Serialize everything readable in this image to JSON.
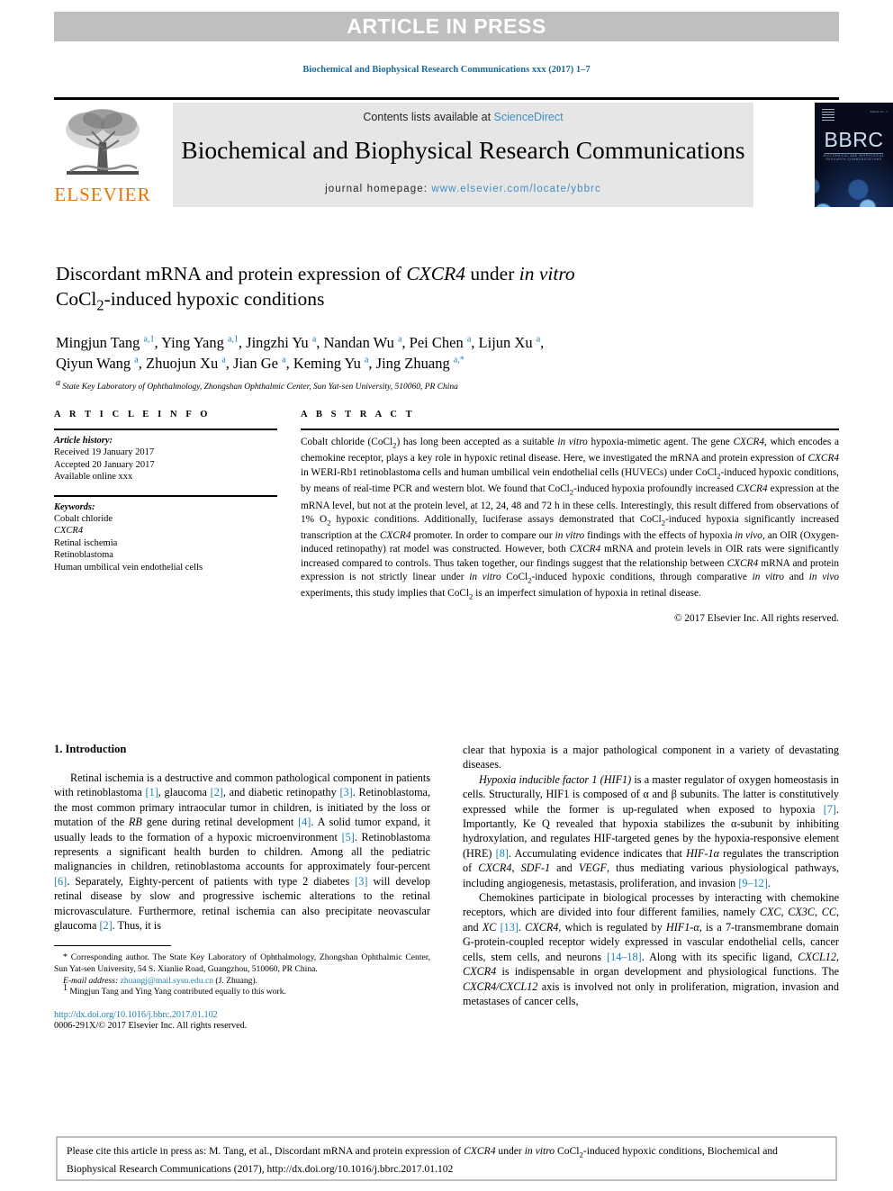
{
  "banner": {
    "label": "ARTICLE IN PRESS"
  },
  "running_head": "Biochemical and Biophysical Research Communications xxx (2017) 1–7",
  "masthead": {
    "publisher_word": "ELSEVIER",
    "contents_prefix": "Contents lists available at ",
    "contents_link": "ScienceDirect",
    "journal_title": "Biochemical and Biophysical Research Communications",
    "homepage_prefix": "journal homepage: ",
    "homepage_url": "www.elsevier.com/locate/ybbrc",
    "cover_word": "BBRC",
    "cover_subtext": "BIOCHEMICAL AND BIOPHYSICAL RESEARCH COMMUNICATIONS",
    "cover_corner_text": "Volume xxx · 1"
  },
  "article": {
    "title_line1": "Discordant mRNA and protein expression of ",
    "title_gene": "CXCR4",
    "title_line1b": " under ",
    "title_invitro": "in vitro",
    "title_line2a": "CoCl",
    "title_line2sub": "2",
    "title_line2b": "-induced hypoxic conditions",
    "authors": [
      {
        "name": "Mingjun Tang",
        "sup": "a,1"
      },
      {
        "name": "Ying Yang",
        "sup": "a,1"
      },
      {
        "name": "Jingzhi Yu",
        "sup": "a"
      },
      {
        "name": "Nandan Wu",
        "sup": "a"
      },
      {
        "name": "Pei Chen",
        "sup": "a"
      },
      {
        "name": "Lijun Xu",
        "sup": "a"
      },
      {
        "name": "Qiyun Wang",
        "sup": "a"
      },
      {
        "name": "Zhuojun Xu",
        "sup": "a"
      },
      {
        "name": "Jian Ge",
        "sup": "a"
      },
      {
        "name": "Keming Yu",
        "sup": "a"
      },
      {
        "name": "Jing Zhuang",
        "sup": "a,*"
      }
    ],
    "affiliation_marker": "a",
    "affiliation": "State Key Laboratory of Ophthalmology, Zhongshan Ophthalmic Center, Sun Yat-sen University, 510060, PR China"
  },
  "info": {
    "heading": "A R T I C L E   I N F O",
    "history_label": "Article history:",
    "history": [
      "Received 19 January 2017",
      "Accepted 20 January 2017",
      "Available online xxx"
    ],
    "keywords_label": "Keywords:",
    "keywords": [
      "Cobalt chloride",
      "CXCR4",
      "Retinal ischemia",
      "Retinoblastoma",
      "Human umbilical vein endothelial cells"
    ]
  },
  "abstract": {
    "heading": "A B S T R A C T",
    "copyright": "© 2017 Elsevier Inc. All rights reserved."
  },
  "introduction": {
    "heading": "1. Introduction"
  },
  "footnotes": {
    "corresponding_marker": "*",
    "corresponding": " Corresponding author. The State Key Laboratory of Ophthalmology, Zhongshan Ophthalmic Center, Sun Yat-sen University, 54 S. Xianlie Road, Guangzhou, 510060, PR China.",
    "email_label": "E-mail address:",
    "email": "zhuangj@mail.sysu.edu.cn",
    "email_suffix": " (J. Zhuang).",
    "equal_marker": "1",
    "equal_contrib": " Mingjun Tang and Ying Yang contributed equally to this work.",
    "doi": "http://dx.doi.org/10.1016/j.bbrc.2017.01.102",
    "issn": "0006-291X/© 2017 Elsevier Inc. All rights reserved."
  },
  "cite_box": {
    "prefix": "Please cite this article in press as: M. Tang, et al., Discordant mRNA and protein expression of ",
    "gene": "CXCR4",
    "mid": " under ",
    "invitro": "in vitro",
    "cocl": " CoCl",
    "cocl_sub": "2",
    "suffix": "-induced hypoxic conditions, Biochemical and Biophysical Research Communications (2017), http://dx.doi.org/10.1016/j.bbrc.2017.01.102"
  },
  "colors": {
    "link": "#1a7fb5",
    "banner_bg": "#bfbfbf",
    "masthead_bg": "#e6e6e6",
    "elsevier_orange": "#ec7300"
  }
}
